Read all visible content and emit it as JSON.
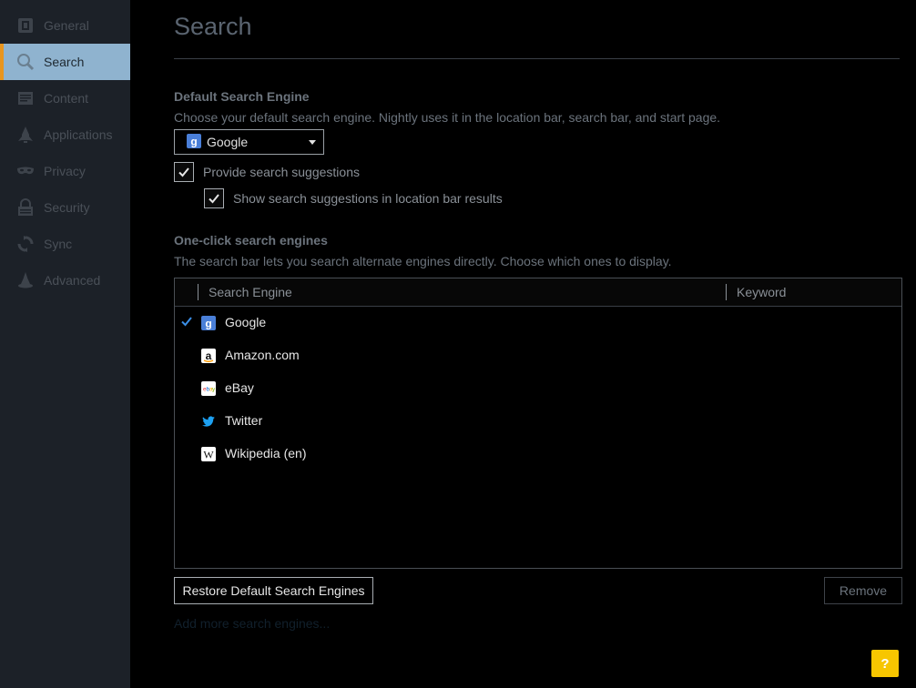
{
  "sidebar": {
    "items": [
      {
        "label": "General",
        "icon": "general-icon",
        "selected": false
      },
      {
        "label": "Search",
        "icon": "search-icon",
        "selected": true
      },
      {
        "label": "Content",
        "icon": "content-icon",
        "selected": false
      },
      {
        "label": "Applications",
        "icon": "applications-icon",
        "selected": false
      },
      {
        "label": "Privacy",
        "icon": "privacy-mask-icon",
        "selected": false
      },
      {
        "label": "Security",
        "icon": "security-lock-icon",
        "selected": false
      },
      {
        "label": "Sync",
        "icon": "sync-icon",
        "selected": false
      },
      {
        "label": "Advanced",
        "icon": "advanced-wizard-icon",
        "selected": false
      }
    ]
  },
  "main": {
    "title": "Search",
    "default_engine": {
      "heading": "Default Search Engine",
      "description": "Choose your default search engine. Nightly uses it in the location bar, search bar, and start page.",
      "selected": "Google",
      "provide_suggestions_label": "Provide search suggestions",
      "provide_suggestions_checked": true,
      "show_suggestions_label": "Show search suggestions in location bar results",
      "show_suggestions_checked": true
    },
    "one_click": {
      "heading": "One-click search engines",
      "description": "The search bar lets you search alternate engines directly. Choose which ones to display.",
      "columns": {
        "engine": "Search Engine",
        "keyword": "Keyword"
      },
      "engines": [
        {
          "name": "Google",
          "icon": "google-icon",
          "checked": true
        },
        {
          "name": "Amazon.com",
          "icon": "amazon-icon",
          "checked": false
        },
        {
          "name": "eBay",
          "icon": "ebay-icon",
          "checked": false
        },
        {
          "name": "Twitter",
          "icon": "twitter-icon",
          "checked": false
        },
        {
          "name": "Wikipedia (en)",
          "icon": "wikipedia-icon",
          "checked": false
        }
      ]
    },
    "restore_button": "Restore Default Search Engines",
    "remove_button": "Remove",
    "add_more_link": "Add more search engines...",
    "help_button": "?"
  },
  "colors": {
    "sidebar_bg": "#1c2128",
    "selected_bg": "#8fb3cf",
    "selected_accent": "#e8951e",
    "check_blue": "#3a8ee6",
    "help_yellow": "#f7c600"
  }
}
